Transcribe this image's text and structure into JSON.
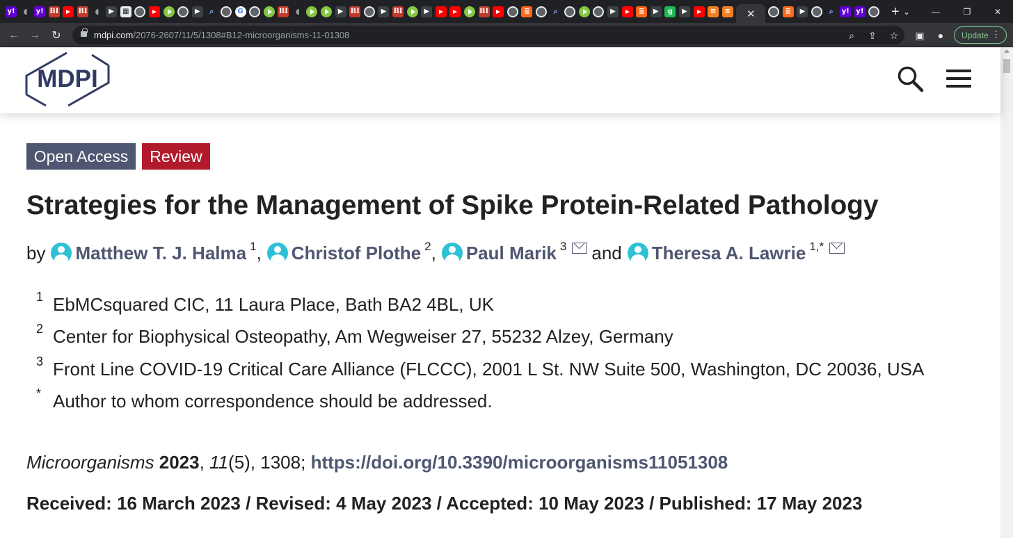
{
  "browser": {
    "tab_favicons": [
      "yahoo",
      "shield",
      "yahoo",
      "bi",
      "yt",
      "bi",
      "shield",
      "dark",
      "image",
      "globe",
      "yt",
      "rumble",
      "globe",
      "dark",
      "search",
      "globe",
      "google",
      "globe",
      "rumble",
      "bi",
      "shield",
      "rumble",
      "rumble",
      "dark",
      "bi",
      "globe",
      "dark",
      "bi",
      "rumble",
      "dark",
      "yt",
      "yt",
      "rumble",
      "bi",
      "yt",
      "globe",
      "sub",
      "globe",
      "search",
      "globe",
      "rumble",
      "globe",
      "dark",
      "yt",
      "sub",
      "dark",
      "green",
      "dark",
      "yt",
      "orange",
      "orange"
    ],
    "active_tab_close": "✕",
    "favicons_after": [
      "globe",
      "sub",
      "dark",
      "globe",
      "search",
      "yahoo",
      "yahoo",
      "globe"
    ],
    "new_tab": "+",
    "url_host": "mdpi.com",
    "url_path": "/2076-2607/11/5/1308#B12-microorganisms-11-01308",
    "update_label": "Update"
  },
  "site": {
    "logo_text": "MDPI",
    "search_icon": "search-icon",
    "menu_icon": "hamburger-menu-icon"
  },
  "article": {
    "badges": {
      "open_access": "Open Access",
      "type": "Review"
    },
    "title": "Strategies for the Management of Spike Protein-Related Pathology",
    "by": "by",
    "authors": [
      {
        "name": "Matthew T. J. Halma",
        "sup": "1",
        "sep": ",",
        "email": false
      },
      {
        "name": "Christof Plothe",
        "sup": "2",
        "sep": ",",
        "email": false
      },
      {
        "name": "Paul Marik",
        "sup": "3",
        "sep": "",
        "email": true
      },
      {
        "name": "Theresa A. Lawrie",
        "sup": "1,*",
        "sep": "",
        "email": true
      }
    ],
    "and": "and",
    "affiliations": [
      {
        "num": "1",
        "text": "EbMCsquared CIC, 11 Laura Place, Bath BA2 4BL, UK"
      },
      {
        "num": "2",
        "text": "Center for Biophysical Osteopathy, Am Wegweiser 27, 55232 Alzey, Germany"
      },
      {
        "num": "3",
        "text": "Front Line COVID-19 Critical Care Alliance (FLCCC), 2001 L St. NW Suite 500, Washington, DC 20036, USA"
      },
      {
        "num": "*",
        "text": "Author to whom correspondence should be addressed."
      }
    ],
    "citation": {
      "journal": "Microorganisms",
      "year": "2023",
      "volume": "11",
      "issue_pages": "(5), 1308;",
      "doi": "https://doi.org/10.3390/microorganisms11051308"
    },
    "dates": "Received: 16 March 2023 / Revised: 4 May 2023 / Accepted: 10 May 2023 / Published: 17 May 2023"
  },
  "colors": {
    "accent": "#4f5671",
    "review_red": "#b11a2b",
    "author_icon": "#2ec1d6"
  }
}
